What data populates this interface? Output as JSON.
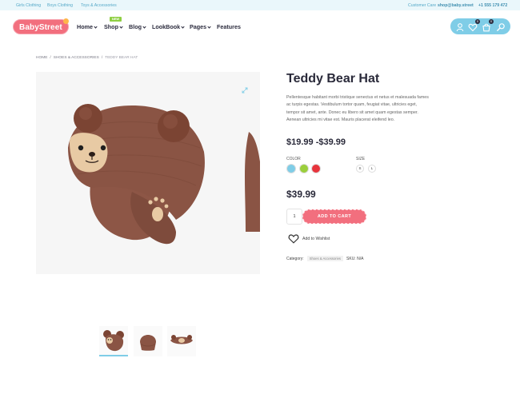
{
  "topbar": {
    "links": [
      "Girls Clothing",
      "Boys Clothing",
      "Toys & Accessories"
    ],
    "care_label": "Customer Care",
    "email": "shop@baby.street",
    "phone": "+1 555 179 472"
  },
  "brand": {
    "name": "BabyStreet"
  },
  "nav": {
    "items": [
      "Home",
      "Shop",
      "Blog",
      "LookBook",
      "Pages",
      "Features"
    ],
    "badge": "NEW"
  },
  "header_icons": {
    "wishlist_count": "0",
    "cart_count": "0"
  },
  "breadcrumb": {
    "home": "Home",
    "category": "Shoes & Accessories",
    "current": "Teddy Bear Hat"
  },
  "product": {
    "title": "Teddy Bear Hat",
    "description": "Pellentesque habitant morbi tristique senectus et netus et malesuada fames ac turpis egestas. Vestibulum tortor quam, feugiat vitae, ultricies eget, tempor sit amet, ante. Donec eu libero sit amet quam egestas semper. Aenean ultricies mi vitae est. Mauris placerat eleifend leo.",
    "price_low": "$19.99",
    "price_sep": "-",
    "price_high": "$39.99",
    "color_label": "Color",
    "size_label": "Size",
    "colors": [
      "#7fcde7",
      "#9bcf3c",
      "#e7343c"
    ],
    "sizes": [
      "S",
      "L"
    ],
    "price": "$39.99",
    "quantity": "1",
    "cart_label": "ADD TO CART",
    "wishlist_label": "Add to Wishlist",
    "category_label": "Category:",
    "category": "Shoes & Accessories",
    "sku_label": "SKU:",
    "sku": "N/A"
  },
  "colors": {
    "accent_pink": "#f26f7e",
    "accent_blue": "#7fcde7",
    "hat_brown": "#8a5444"
  }
}
